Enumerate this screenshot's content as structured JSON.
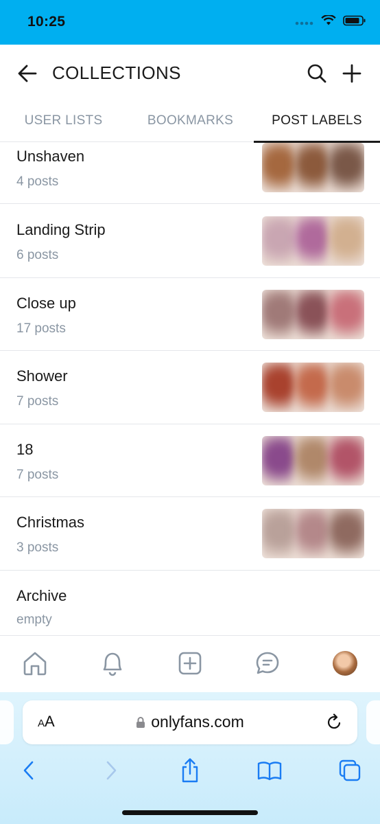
{
  "status_bar": {
    "time": "10:25",
    "color": "#00aff0"
  },
  "header": {
    "title": "COLLECTIONS",
    "back_icon": "arrow-left-icon",
    "search_icon": "search-icon",
    "add_icon": "plus-icon"
  },
  "tabs": [
    {
      "label": "USER LISTS",
      "active": false
    },
    {
      "label": "BOOKMARKS",
      "active": false
    },
    {
      "label": "POST LABELS",
      "active": true
    }
  ],
  "labels": [
    {
      "name": "Unshaven",
      "count": "4 posts",
      "thumbs": [
        "#a5683f",
        "#8c5a3c",
        "#7a5848"
      ]
    },
    {
      "name": "Landing Strip",
      "count": "6 posts",
      "thumbs": [
        "#c9a6b2",
        "#b06a9c",
        "#d2b090"
      ]
    },
    {
      "name": "Close up",
      "count": "17 posts",
      "thumbs": [
        "#a07a78",
        "#8a5258",
        "#c9707a"
      ]
    },
    {
      "name": "Shower",
      "count": "7 posts",
      "thumbs": [
        "#a9422e",
        "#c46a4c",
        "#c98b6c"
      ]
    },
    {
      "name": "18",
      "count": "7 posts",
      "thumbs": [
        "#8a4a8c",
        "#b0886a",
        "#b25468"
      ]
    },
    {
      "name": "Christmas",
      "count": "3 posts",
      "thumbs": [
        "#b9a19a",
        "#b4888a",
        "#8f6a60"
      ]
    },
    {
      "name": "Archive",
      "count": "empty",
      "thumbs": []
    }
  ],
  "bottom_nav": [
    {
      "name": "home-icon"
    },
    {
      "name": "bell-icon"
    },
    {
      "name": "add-post-icon"
    },
    {
      "name": "messages-icon"
    },
    {
      "name": "avatar"
    }
  ],
  "browser": {
    "aa_label_small": "A",
    "aa_label_big": "A",
    "url": "onlyfans.com",
    "lock_icon": "lock-icon",
    "reload_icon": "reload-icon",
    "toolbar": [
      "back-icon",
      "forward-icon",
      "share-icon",
      "bookmarks-icon",
      "tabs-icon"
    ],
    "accent": "#1a7cf3"
  }
}
